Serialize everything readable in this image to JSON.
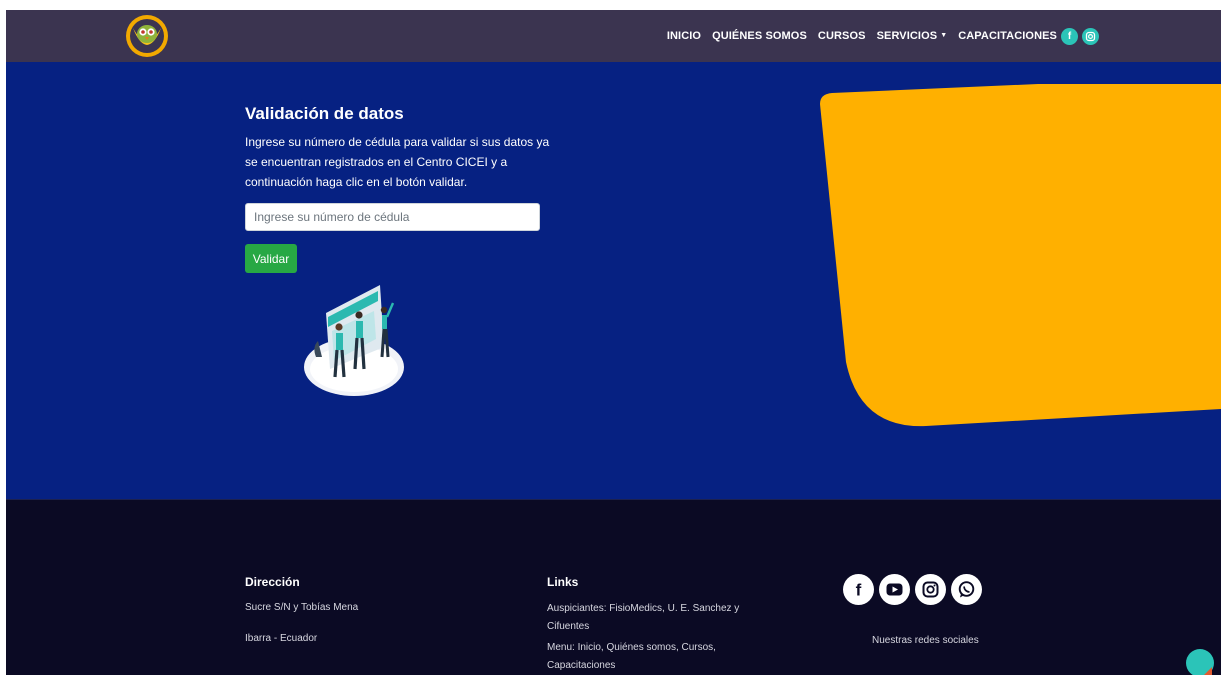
{
  "navbar": {
    "links": [
      "INICIO",
      "QUIÉNES SOMOS",
      "CURSOS",
      "SERVICIOS",
      "CAPACITACIONES"
    ],
    "dropdown_link_index": 3,
    "social_icons": [
      "facebook-icon",
      "instagram-icon"
    ]
  },
  "hero": {
    "title": "Validación de datos",
    "description": "Ingrese su número de cédula para validar si sus datos ya se encuentran registrados en el Centro CICEI y a continuación haga clic en el botón validar.",
    "input_placeholder": "Ingrese su número de cédula",
    "input_value": "",
    "button_label": "Validar"
  },
  "footer": {
    "direccion": {
      "heading": "Dirección",
      "line1": "Sucre S/N y Tobías Mena",
      "line2": "Ibarra - Ecuador"
    },
    "links": {
      "heading": "Links",
      "auspiciantes": "Auspiciantes: FisioMedics, U. E. Sanchez y Cifuentes",
      "menu": "Menu: Inicio, Quiénes somos, Cursos, Capacitaciones"
    },
    "social": {
      "icons": [
        "facebook-icon",
        "youtube-icon",
        "instagram-icon",
        "whatsapp-icon"
      ],
      "caption": "Nuestras redes sociales"
    }
  },
  "colors": {
    "navbar_bg": "#3b3450",
    "hero_bg": "#062182",
    "accent_yellow": "#ffb000",
    "button_green": "#27a844",
    "social_teal": "#2bc4b8",
    "footer_bg": "#0b0a24"
  }
}
